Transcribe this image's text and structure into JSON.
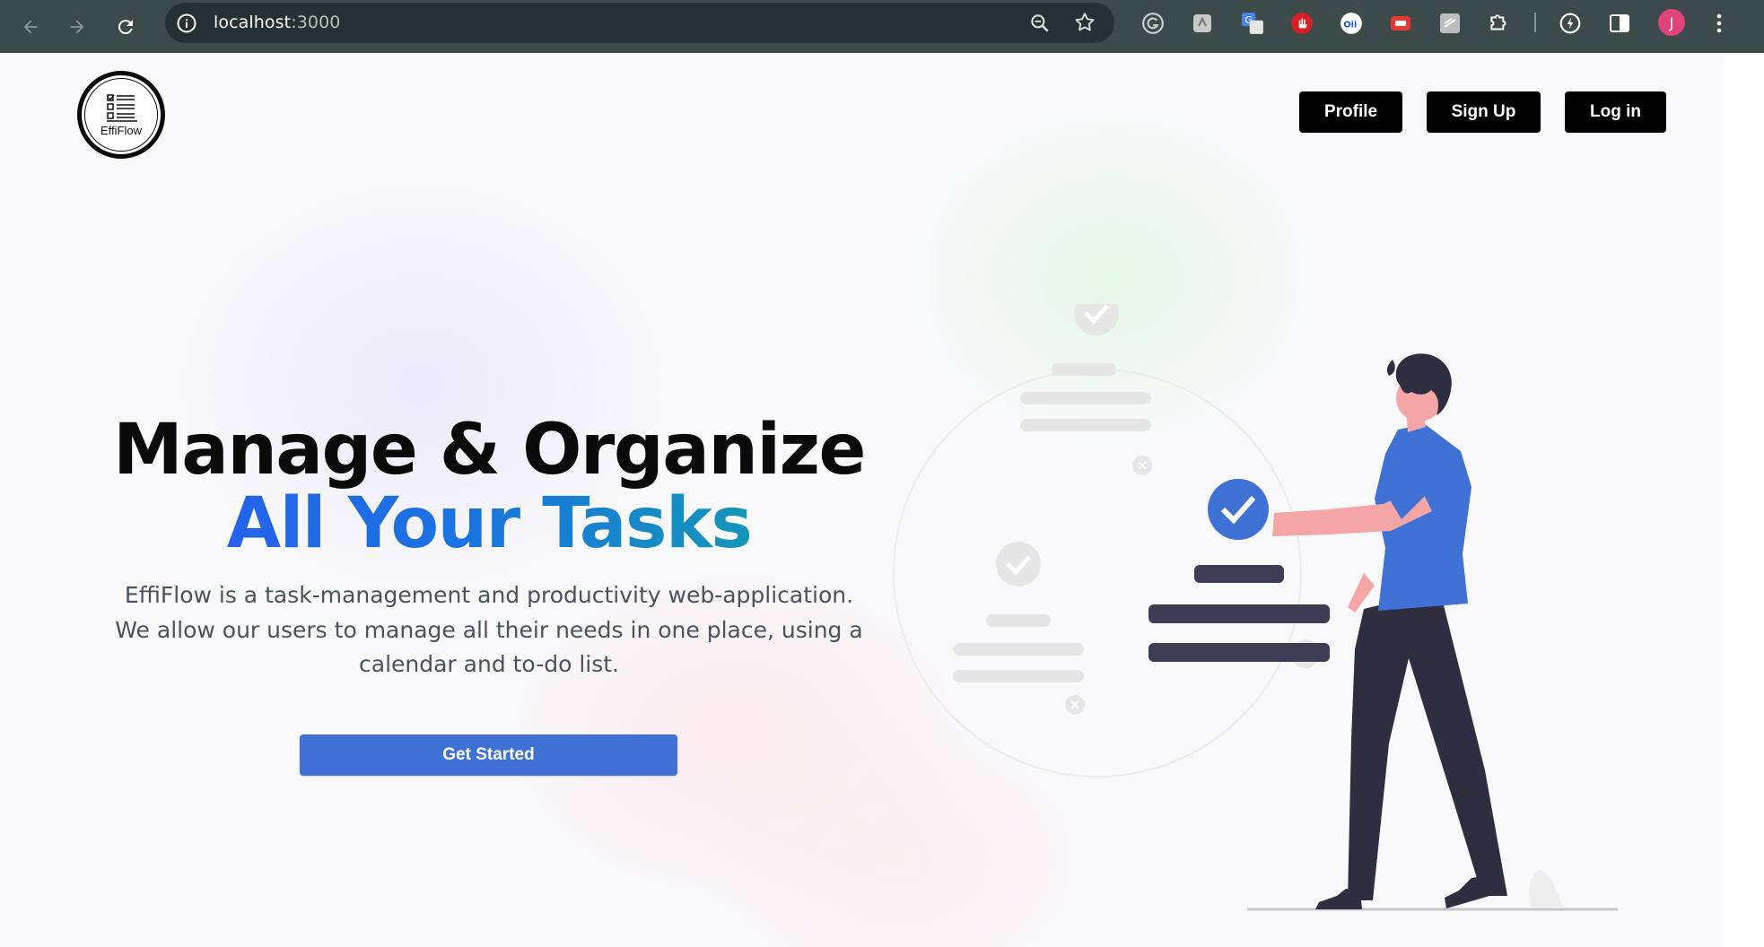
{
  "browser": {
    "url_host": "localhost",
    "url_port": ":3000",
    "profile_initial": "J"
  },
  "header": {
    "logo_text": "EffiFlow",
    "nav": {
      "profile": "Profile",
      "signup": "Sign Up",
      "login": "Log in"
    }
  },
  "hero": {
    "title_line1": "Manage & Organize",
    "title_line2": "All Your Tasks",
    "description": "EffiFlow is a task-management and productivity web-application. We allow our users to manage all their needs in one place, using a calendar and to-do list.",
    "cta": "Get Started"
  },
  "colors": {
    "accent_blue": "#3f72d4",
    "title_gradient_start": "#2563eb",
    "title_gradient_end": "#1596b8",
    "dark_ink": "#2f2e41",
    "skin": "#f4a6a6"
  }
}
